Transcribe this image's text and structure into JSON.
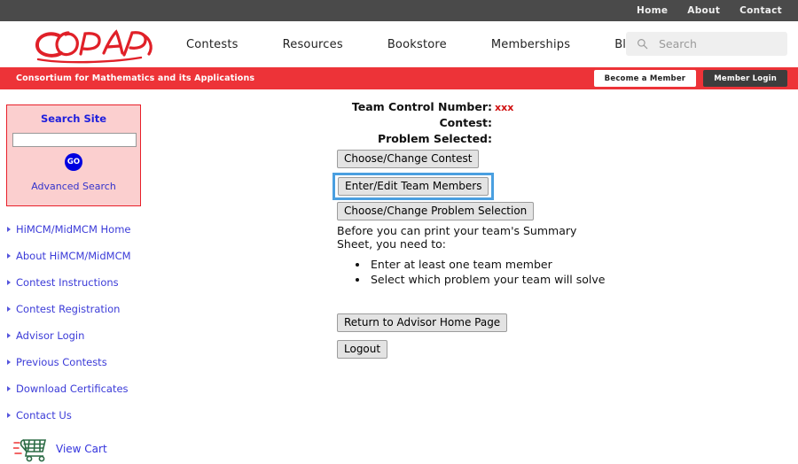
{
  "topbar": {
    "links": [
      {
        "label": "Home"
      },
      {
        "label": "About"
      },
      {
        "label": "Contact"
      }
    ]
  },
  "mainnav": {
    "logo_text": "COMAP",
    "links": [
      {
        "label": "Contests"
      },
      {
        "label": "Resources"
      },
      {
        "label": "Bookstore"
      },
      {
        "label": "Memberships"
      },
      {
        "label": "Blog"
      }
    ],
    "search": {
      "placeholder": "Search",
      "value": "",
      "icon": "search-icon"
    }
  },
  "redbar": {
    "tagline": "Consortium for Mathematics and its Applications",
    "become_member_label": "Become a Member",
    "member_login_label": "Member Login",
    "background_color": "#ed3338"
  },
  "sidebar": {
    "search_panel": {
      "title": "Search Site",
      "field_value": "",
      "go_label": "GO",
      "advanced_label": "Advanced Search",
      "border_color": "#e8202a",
      "background_color": "#fbcfcf",
      "title_color": "#2020dd",
      "go_color": "#0000e0"
    },
    "items": [
      {
        "label": "HiMCM/MidMCM Home"
      },
      {
        "label": "About HiMCM/MidMCM"
      },
      {
        "label": "Contest Instructions"
      },
      {
        "label": "Contest Registration"
      },
      {
        "label": "Advisor Login"
      },
      {
        "label": "Previous Contests"
      },
      {
        "label": "Download Certificates"
      },
      {
        "label": "Contact Us"
      }
    ],
    "cart": {
      "label": "View Cart",
      "icon": "shopping-cart-icon"
    }
  },
  "main": {
    "info": [
      {
        "label": "Team Control Number:",
        "value": "xxx",
        "value_style": "red"
      },
      {
        "label": "Contest:",
        "value": "",
        "value_style": "normal"
      },
      {
        "label": "Problem Selected:",
        "value": "",
        "value_style": "normal"
      }
    ],
    "buttons": {
      "choose_contest": "Choose/Change Contest",
      "enter_team_members": "Enter/Edit Team Members",
      "choose_problem": "Choose/Change Problem Selection",
      "return_advisor": "Return to Advisor Home Page",
      "logout": "Logout"
    },
    "highlight_color": "#4a9fe0",
    "instructions": "Before you can print your team's Summary Sheet, you need to:",
    "requirements": [
      {
        "text": "Enter at least one team member"
      },
      {
        "text": "Select which problem your team will solve"
      }
    ]
  }
}
